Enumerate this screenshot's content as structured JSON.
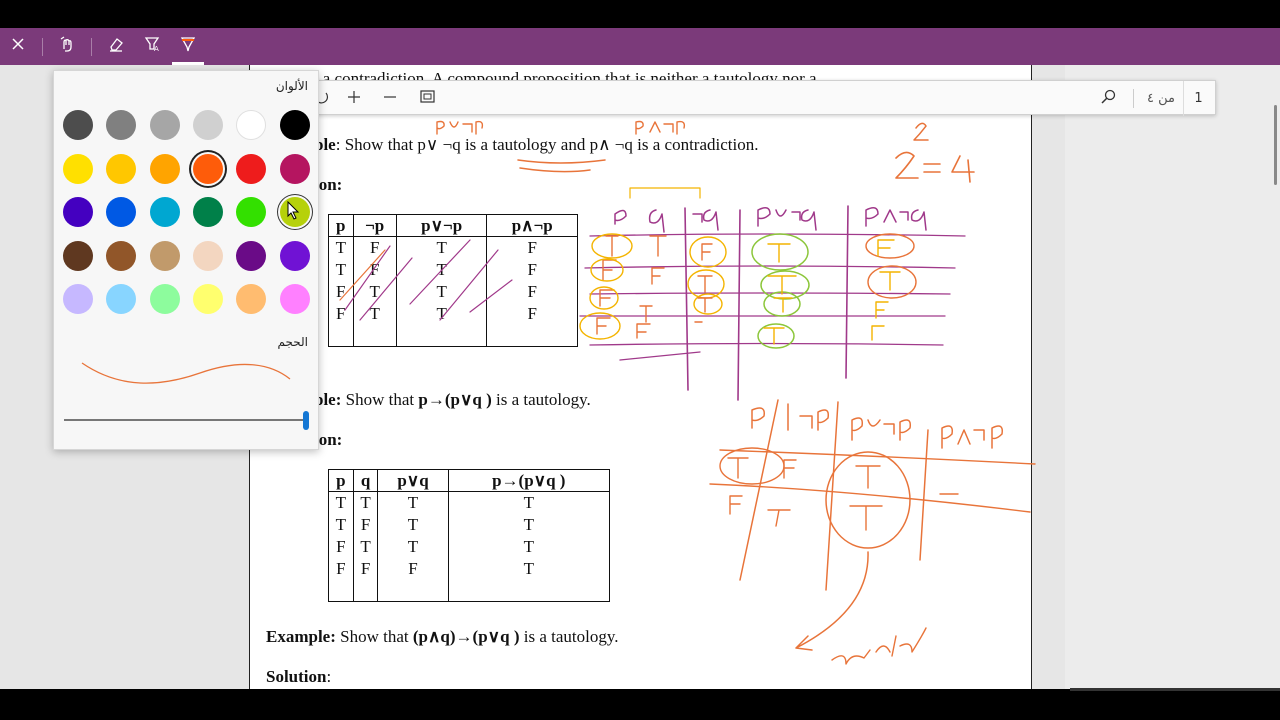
{
  "toolbar": {
    "close_icon": "close-icon",
    "tools": [
      "touch-write-icon",
      "eraser-icon",
      "highlighter-icon",
      "pen-icon"
    ],
    "active_tool": "pen"
  },
  "findbar": {
    "page_current": "1",
    "page_total": "من ٤",
    "buttons": [
      "search-icon",
      "fit-page-icon",
      "zoom-out-icon",
      "zoom-in-icon"
    ]
  },
  "color_panel": {
    "colors_label": "الألوان",
    "size_label": "الحجم",
    "selected_color": "#fe5c0a",
    "hover_color": "#b6d10b",
    "swatches": [
      "#4d4d4d",
      "#808080",
      "#a6a6a6",
      "#d0d0d0",
      "#ffffff",
      "#000000",
      "#ffe000",
      "#ffc700",
      "#ffa400",
      "#fe5c0a",
      "#ee1c1c",
      "#b51560",
      "#4400c0",
      "#0059e4",
      "#00a7d1",
      "#008049",
      "#33e000",
      "#b6d10b",
      "#5f3820",
      "#915629",
      "#c19a6b",
      "#f3d6c0",
      "#6a0b87",
      "#7012d4",
      "#c6b8ff",
      "#88d5ff",
      "#8dfc9d",
      "#ffff6e",
      "#ffbc70",
      "#ff80ff"
    ],
    "size_level": 1.0
  },
  "document": {
    "partial_top": "d a contradiction. A compound proposition that is neither a tautology nor a",
    "ex1_prefix": "ple",
    "ex1_text": ": Show that  p∨ ¬q is a tautology and p∧ ¬q is a contradiction.",
    "sol1": "ion:",
    "table1": {
      "headers": [
        "p",
        "¬p",
        "p∨¬p",
        "p∧¬p"
      ],
      "rows": [
        [
          "T",
          "F",
          "T",
          "F"
        ],
        [
          "T",
          "F",
          "T",
          "F"
        ],
        [
          "F",
          "T",
          "T",
          "F"
        ],
        [
          "F",
          "T",
          "T",
          "F"
        ]
      ]
    },
    "ex2_prefix": "ple:",
    "ex2_text": " Show that ",
    "ex2_formula": "p→(p∨q )",
    "ex2_suffix": " is a tautology.",
    "sol2": "ion:",
    "table2": {
      "headers": [
        "p",
        "q",
        "p∨q",
        "p→(p∨q )"
      ],
      "rows": [
        [
          "T",
          "T",
          "T",
          "T"
        ],
        [
          "T",
          "F",
          "T",
          "T"
        ],
        [
          "F",
          "T",
          "T",
          "T"
        ],
        [
          "F",
          "F",
          "F",
          "T"
        ]
      ]
    },
    "ex3_label": "Example:",
    "ex3_text": " Show that ",
    "ex3_formula": "(p∧q)→(p∨q )",
    "ex3_suffix": " is a tautology.",
    "sol3": "Solution",
    "sol3_colon": ":"
  },
  "ink": {
    "annotations": [
      "p∨¬p",
      "p∧¬p",
      "2",
      "2 = 4",
      "p",
      "q",
      "¬q",
      "p∨¬q",
      "p∧¬q",
      "p",
      "¬p",
      "p∨¬p",
      "p∧¬p",
      "tautol"
    ],
    "colors": {
      "orange": "#e8743a",
      "purple": "#a0398a",
      "green": "#8cc63a",
      "yellow": "#f4b400"
    }
  }
}
